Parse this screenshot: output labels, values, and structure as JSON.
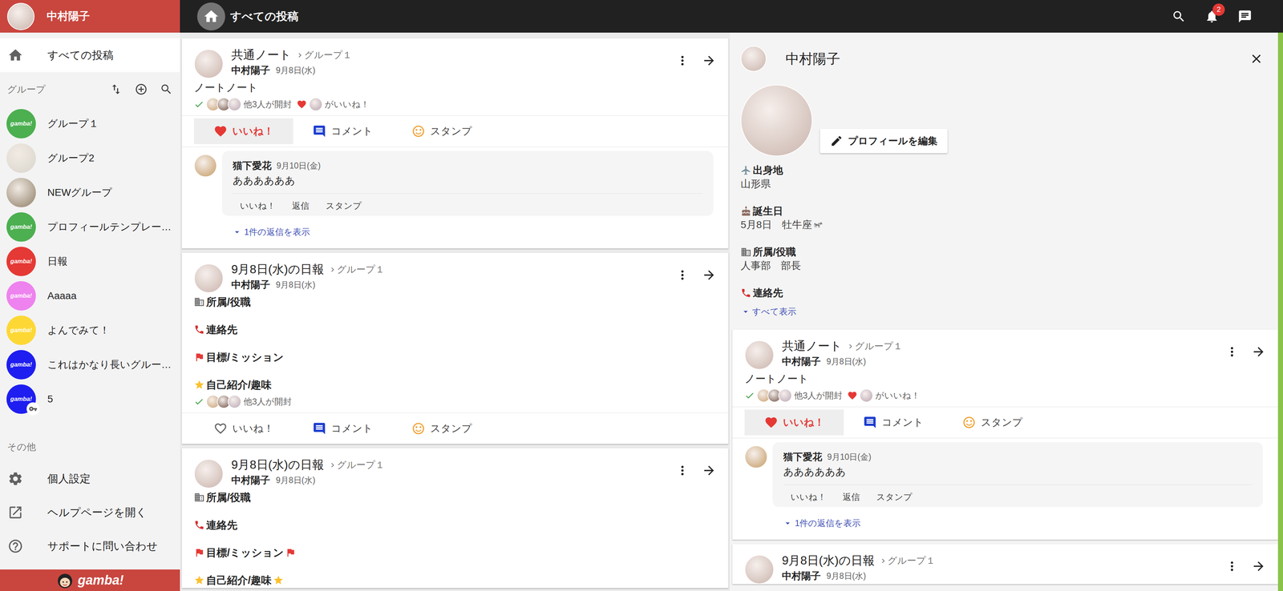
{
  "user": {
    "name": "中村陽子"
  },
  "header": {
    "title": "すべての投稿",
    "notifications": "2"
  },
  "sidebar": {
    "items": [
      {
        "label": "すべての投稿",
        "selected": true
      }
    ],
    "groups_label": "グループ",
    "groups": [
      {
        "name": "グループ１",
        "avatar": {
          "kind": "logo",
          "text": "gamba!",
          "color": "#4caf50"
        },
        "locked": false
      },
      {
        "name": "グループ2",
        "avatar": {
          "kind": "photo",
          "color": "#d9d4cb"
        },
        "locked": false
      },
      {
        "name": "NEWグループ",
        "avatar": {
          "kind": "photo",
          "color": "#8d7b63"
        },
        "locked": false
      },
      {
        "name": "プロフィールテンプレー…",
        "avatar": {
          "kind": "logo",
          "text": "gamba!",
          "color": "#4caf50"
        },
        "locked": false
      },
      {
        "name": "日報",
        "avatar": {
          "kind": "logo",
          "text": "gamba!",
          "color": "#e53935"
        },
        "locked": false
      },
      {
        "name": "Aaaaa",
        "avatar": {
          "kind": "logo",
          "text": "gamba!",
          "color": "#ee82ee"
        },
        "locked": false
      },
      {
        "name": "よんでみて！",
        "avatar": {
          "kind": "logo",
          "text": "gamba!",
          "color": "#fdd835"
        },
        "locked": false
      },
      {
        "name": "これはかなり長いグルー…",
        "avatar": {
          "kind": "logo",
          "text": "gamba!",
          "color": "#1e1ef0"
        },
        "locked": false
      },
      {
        "name": "5",
        "avatar": {
          "kind": "logo",
          "text": "gamba!",
          "color": "#1e1ef0"
        },
        "locked": true
      }
    ],
    "other_label": "その他",
    "other_items": [
      {
        "label": "個人設定",
        "kind": "settings"
      },
      {
        "label": "ヘルプページを開く",
        "kind": "external"
      },
      {
        "label": "サポートに問い合わせ",
        "kind": "support"
      }
    ],
    "footer": {
      "logo": "gamba!"
    }
  },
  "feed": {
    "posts": [
      {
        "title": "共通ノート",
        "group": "グループ１",
        "author": "中村陽子",
        "date": "9月8日(水)",
        "body": [
          {
            "kind": "text",
            "text": "ノートノート",
            "trailing": false
          }
        ],
        "reads": {
          "avatars": [
            "#c8a06e",
            "#6d5045",
            "#b9a7b3"
          ],
          "label": "他3人が開封"
        },
        "likes": {
          "avatars": [
            "#b7a3ad"
          ],
          "label": "がいいね！"
        },
        "actions": [
          {
            "label": "いいね！",
            "kind": "like",
            "selected": true
          },
          {
            "label": "コメント",
            "kind": "comment",
            "selected": false
          },
          {
            "label": "スタンプ",
            "kind": "stamp",
            "selected": false
          }
        ],
        "comments": [
          {
            "author": "猫下愛花",
            "date": "9月10日(金)",
            "text": "ああああああ",
            "avatar_color": "#c49a62",
            "actions": [
              "いいね！",
              "返信",
              "スタンプ"
            ],
            "replies": "1件の返信を表示"
          }
        ]
      },
      {
        "title": "9月8日(水)の日報",
        "group": "グループ１",
        "author": "中村陽子",
        "date": "9月8日(水)",
        "body": [
          {
            "kind": "building",
            "text": "所属/役職",
            "trailing": false
          },
          {
            "kind": "phone",
            "text": "連絡先",
            "trailing": false
          },
          {
            "kind": "flag",
            "text": "目標/ミッション",
            "trailing": false
          },
          {
            "kind": "star",
            "text": "自己紹介/趣味",
            "trailing": false
          }
        ],
        "reads": {
          "avatars": [
            "#c8a06e",
            "#6d5045",
            "#b9a7b3"
          ],
          "label": "他3人が開封"
        },
        "actions": [
          {
            "label": "いいね！",
            "kind": "like",
            "selected": false
          },
          {
            "label": "コメント",
            "kind": "comment",
            "selected": false
          },
          {
            "label": "スタンプ",
            "kind": "stamp",
            "selected": false
          }
        ]
      },
      {
        "title": "9月8日(水)の日報",
        "group": "グループ１",
        "author": "中村陽子",
        "date": "9月8日(水)",
        "body": [
          {
            "kind": "building",
            "text": "所属/役職",
            "trailing": false
          },
          {
            "kind": "phone",
            "text": "連絡先",
            "trailing": false
          },
          {
            "kind": "flag",
            "text": "目標/ミッション",
            "trailing": true
          },
          {
            "kind": "star",
            "text": "自己紹介/趣味",
            "trailing": true
          }
        ]
      }
    ]
  },
  "profile": {
    "name": "中村陽子",
    "edit_label": "プロフィールを編集",
    "fields": [
      {
        "kind": "birthplace",
        "label": "出身地",
        "value": "山形県"
      },
      {
        "kind": "birthday",
        "label": "誕生日",
        "value": "5月8日　牡牛座"
      },
      {
        "kind": "department",
        "label": "所属/役職",
        "value": "人事部　部長"
      },
      {
        "kind": "contact",
        "label": "連絡先"
      }
    ],
    "show_all": "すべて表示",
    "posts": [
      {
        "title": "共通ノート",
        "group": "グループ１",
        "author": "中村陽子",
        "date": "9月8日(水)",
        "body": [
          {
            "kind": "text",
            "text": "ノートノート",
            "trailing": false
          }
        ],
        "reads": {
          "avatars": [
            "#c8a06e",
            "#6d5045",
            "#b9a7b3"
          ],
          "label": "他3人が開封"
        },
        "likes": {
          "avatars": [
            "#b7a3ad"
          ],
          "label": "がいいね！"
        },
        "actions": [
          {
            "label": "いいね！",
            "kind": "like",
            "selected": true
          },
          {
            "label": "コメント",
            "kind": "comment",
            "selected": false
          },
          {
            "label": "スタンプ",
            "kind": "stamp",
            "selected": false
          }
        ],
        "comments": [
          {
            "author": "猫下愛花",
            "date": "9月10日(金)",
            "text": "ああああああ",
            "avatar_color": "#c49a62",
            "actions": [
              "いいね！",
              "返信",
              "スタンプ"
            ],
            "replies": "1件の返信を表示"
          }
        ]
      },
      {
        "title": "9月8日(水)の日報",
        "group": "グループ１",
        "author": "中村陽子",
        "date": "9月8日(水)",
        "body": []
      }
    ]
  }
}
